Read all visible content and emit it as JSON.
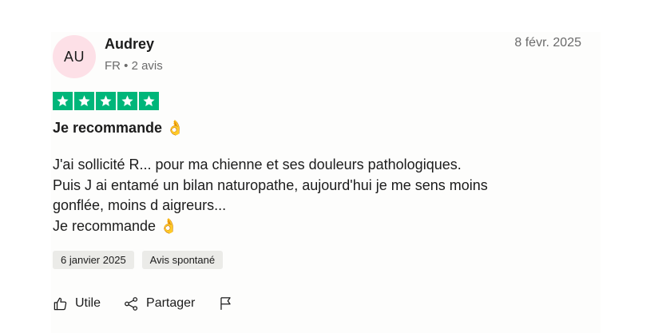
{
  "review": {
    "avatar_initials": "AU",
    "author_name": "Audrey",
    "author_meta": "FR • 2 avis",
    "date": "8 févr. 2025",
    "rating": 5,
    "title": "Je recommande 👌",
    "body_lines": [
      "J'ai sollicité R... pour ma chienne et ses douleurs pathologiques.",
      "Puis J ai entamé un bilan naturopathe, aujourd'hui je me sens moins",
      "gonflée, moins d aigreurs...",
      "Je recommande 👌"
    ],
    "tags": [
      "6 janvier 2025",
      "Avis spontané"
    ]
  },
  "actions": {
    "useful_label": "Utile",
    "share_label": "Partager"
  },
  "colors": {
    "star_green": "#00b67a",
    "avatar_bg": "#fde0e7",
    "tag_bg": "#ebebe8"
  },
  "icons": [
    "thumbs-up-icon",
    "share-icon",
    "flag-icon",
    "star-icon"
  ]
}
